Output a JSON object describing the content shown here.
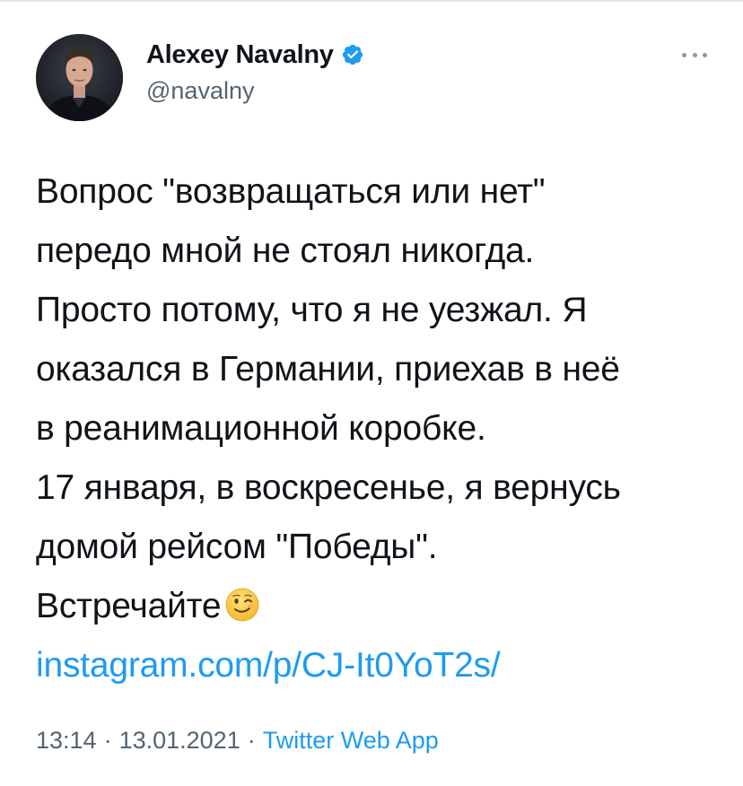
{
  "author": {
    "display_name": "Alexey Navalny",
    "handle": "@navalny",
    "verified": true
  },
  "tweet": {
    "lines": [
      "Вопрос \"возвращаться или нет\"",
      "передо мной не стоял никогда.",
      "Просто потому, что я не уезжал. Я",
      "оказался в Германии, приехав в неё",
      "в реанимационной коробке.",
      "17 января, в воскресенье, я вернусь",
      "домой рейсом \"Победы\".",
      "Встречайте"
    ],
    "emoji": "winking-face",
    "link_text": "instagram.com/p/CJ-It0YoT2s/"
  },
  "meta": {
    "time": "13:14",
    "separator": "·",
    "date": "13.01.2021",
    "source": "Twitter Web App"
  },
  "colors": {
    "link": "#1d9bf0",
    "secondary_text": "#536471",
    "primary_text": "#0f1419",
    "verified_badge": "#1d9bf0"
  },
  "icons": {
    "more": "more-icon",
    "verified": "verified-badge-icon"
  }
}
